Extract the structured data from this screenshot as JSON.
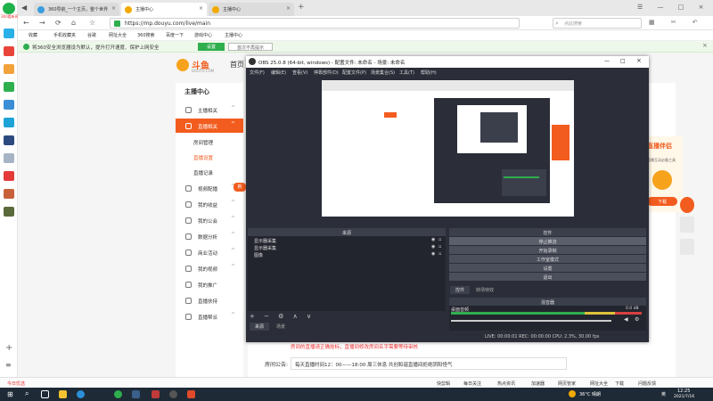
{
  "browser": {
    "tabs": [
      {
        "title": "360导航_一个主页，整个世界",
        "active": false
      },
      {
        "title": "主播中心",
        "active": true
      },
      {
        "title": "主播中心",
        "active": false
      }
    ],
    "url": "https://mp.douyu.com/live/main",
    "search_placeholder": "点此搜索",
    "bookmarks": [
      "收藏",
      "手机收藏夹",
      "谷歌",
      "网址大全",
      "360搜索",
      "百度一下",
      "游戏中心",
      "主播中心"
    ],
    "notice_text": "将360安全浏览器设为默认，提升打开速度、保护上网安全",
    "notice_primary": "设置",
    "notice_secondary": "首次不再提示"
  },
  "left_sidebar_label": "360看新闻",
  "page": {
    "logo_text": "斗鱼",
    "logo_sub": "DOUYU.COM",
    "nav_home": "首页",
    "menu_title": "主播中心",
    "menu_items": [
      {
        "label": "主播相关",
        "chev": "^"
      },
      {
        "label": "直播相关",
        "chev": "^",
        "active": true
      },
      {
        "label": "视频配播",
        "chev": "^"
      },
      {
        "label": "我的收益",
        "chev": "^"
      },
      {
        "label": "我的公会",
        "chev": "^"
      },
      {
        "label": "数据分析",
        "chev": "^"
      },
      {
        "label": "商业活动",
        "chev": "^"
      },
      {
        "label": "我的视频",
        "chev": "^"
      },
      {
        "label": "我的推广",
        "chev": ""
      },
      {
        "label": "直播扶持",
        "chev": ""
      },
      {
        "label": "直播帮派",
        "chev": "^"
      }
    ],
    "submenu": [
      "房间管理",
      "直播设置",
      "直播记录"
    ],
    "new_badge": "新",
    "notice_label": "房间公告:",
    "notice_value": "每天直播时间12：00——18:00 周三休息 共创和谐直播间拒绝阴阳怪气",
    "red_hint": "房间的直播请正确挂标，直播间修改房间名字需要等待审核",
    "right_banner_title": "直播伴侣",
    "right_banner_sub": "直播互动必备工具",
    "right_banner_btn": "下载"
  },
  "obs": {
    "title": "OBS 25.0.8 (64-bit, windows) - 配置文件: 未命名 - 场景: 未命名",
    "menu": [
      "文件(F)",
      "编辑(E)",
      "查看(V)",
      "停靠部件(D)",
      "配置文件(P)",
      "场景集合(S)",
      "工具(T)",
      "帮助(H)"
    ],
    "sources_title": "来源",
    "sources": [
      "显示器采集",
      "显示器采集",
      "图像"
    ],
    "controls_title": "控件",
    "controls": [
      "停止推流",
      "开始录制",
      "工作室模式",
      "设置",
      "退出"
    ],
    "tabs": [
      "控件",
      "转场特效"
    ],
    "mixer_title": "混音器",
    "mixer_track": "桌面音频",
    "mixer_db": "0.0 dB",
    "bottom_tabs": [
      "来源",
      "场景"
    ],
    "status": "LIVE: 00:00:01   REC: 00:00:00   CPU: 2.3%, 30.00 fps",
    "window_controls": [
      "—",
      "□",
      "×"
    ]
  },
  "browser_bottom": {
    "left": "今日优选",
    "items": [
      "快剪辑",
      "每日关注",
      "热点资讯",
      "加速器",
      "网页管家",
      "网址大全",
      "下载",
      "问题反馈"
    ]
  },
  "taskbar": {
    "temp": "36°C 晴朗",
    "lang": "英",
    "time": "12:25",
    "date": "2021/7/16"
  }
}
